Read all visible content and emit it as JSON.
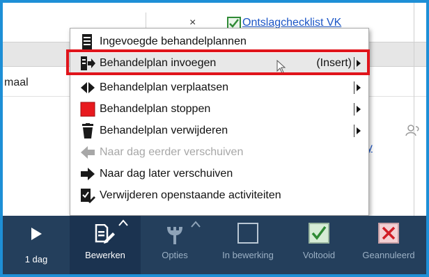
{
  "background": {
    "row_text": "maal",
    "x_mark": "×",
    "link_top": "Ontslagchecklist VK",
    "link_side": "py"
  },
  "menu": {
    "items": [
      {
        "label": "Ingevoegde behandelplannen",
        "icon": "list-icon",
        "shortcut": "",
        "submenu": false,
        "disabled": false
      },
      {
        "label": "Behandelplan invoegen",
        "icon": "insert-plan-icon",
        "shortcut": "(Insert)",
        "submenu": true,
        "disabled": false,
        "highlighted": true
      },
      {
        "label": "Behandelplan verplaatsen",
        "icon": "move-icon",
        "shortcut": "",
        "submenu": true,
        "disabled": false
      },
      {
        "label": "Behandelplan stoppen",
        "icon": "stop-square-icon",
        "shortcut": "",
        "submenu": true,
        "disabled": false
      },
      {
        "label": "Behandelplan verwijderen",
        "icon": "trash-icon",
        "shortcut": "",
        "submenu": true,
        "disabled": false
      },
      {
        "label": "Naar dag eerder verschuiven",
        "icon": "arrow-left-icon",
        "shortcut": "",
        "submenu": false,
        "disabled": true
      },
      {
        "label": "Naar dag later verschuiven",
        "icon": "arrow-right-icon",
        "shortcut": "",
        "submenu": false,
        "disabled": false
      },
      {
        "label": "Verwijderen openstaande activiteiten",
        "icon": "clear-activities-icon",
        "shortcut": "",
        "submenu": false,
        "disabled": false
      }
    ]
  },
  "toolbar": {
    "day": {
      "label": "1 dag",
      "icon": "play-icon"
    },
    "edit": {
      "label": "Bewerken",
      "icon": "edit-document-icon"
    },
    "options": {
      "label": "Opties",
      "icon": "wrench-icon"
    },
    "in_progress": {
      "label": "In bewerking",
      "icon": "empty-checkbox-icon"
    },
    "done": {
      "label": "Voltooid",
      "icon": "checked-checkbox-icon"
    },
    "cancelled": {
      "label": "Geannuleerd",
      "icon": "crossed-checkbox-icon"
    }
  },
  "colors": {
    "frame": "#1e8fd6",
    "toolbar": "#243f5c",
    "highlight_border": "#e0141b",
    "stop_red": "#e8191e",
    "link": "#1c56c6"
  }
}
